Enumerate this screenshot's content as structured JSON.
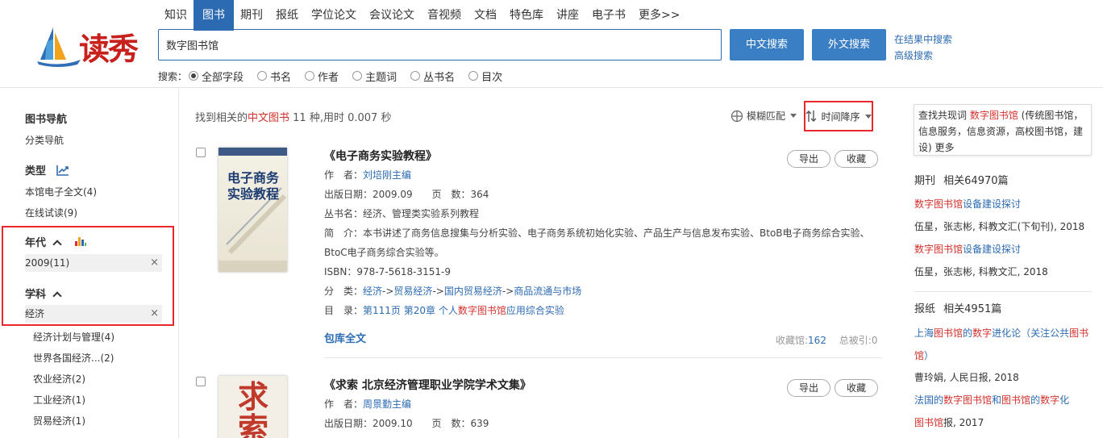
{
  "header": {
    "logo_text": "读秀",
    "nav": [
      "知识",
      "图书",
      "期刊",
      "报纸",
      "学位论文",
      "会议论文",
      "音视频",
      "文档",
      "特色库",
      "讲座",
      "电子书",
      "更多>>"
    ],
    "nav_active": "图书",
    "search_value": "数字图书馆",
    "btn_cn": "中文搜索",
    "btn_en": "外文搜索",
    "link_within": "在结果中搜索",
    "link_advanced": "高级搜索",
    "fields_label": "搜索：",
    "fields": [
      "全部字段",
      "书名",
      "作者",
      "主题词",
      "丛书名",
      "目次"
    ]
  },
  "left": {
    "nav_title": "图书导航",
    "nav_sub": "分类导航",
    "type_title": "类型",
    "type_items": [
      "本馆电子全文(4)",
      "在线试读(9)"
    ],
    "year_title": "年代",
    "year_selected": "2009(11)",
    "subject_title": "学科",
    "subject_selected": "经济",
    "subject_items": [
      "经济计划与管理(4)",
      "世界各国经济...(2)",
      "农业经济(2)",
      "工业经济(1)",
      "贸易经济(1)"
    ],
    "close": "×"
  },
  "main": {
    "summary_prefix": "找到相关的",
    "summary_hl": "中文图书",
    "summary_suffix": " 11 种,用时 0.007 秒",
    "fuzzy": "模糊匹配",
    "sort": "时间降序",
    "books": [
      {
        "title": "《电子商务实验教程》",
        "author_label": "作　者：",
        "author": "刘培刚主编",
        "date_label": "出版日期：",
        "date": "2009.09",
        "pages_label": "页　数：",
        "pages": "364",
        "series_label": "丛书名：",
        "series": "经济、管理类实验系列教程",
        "intro_label": "简　介：",
        "intro_1": "本书讲述了商务信息搜集与分析实验、电子商务系统初始化实验、产品生产与信息发布实验、BtoB电子商务综合实验、",
        "intro_2": "BtoC电子商务综合实验等。",
        "isbn_label": "ISBN：",
        "isbn": "978-7-5618-3151-9",
        "class_label": "分　类：",
        "class": [
          "经济",
          "贸易经济",
          "国内贸易经济",
          "商品流通与市场"
        ],
        "class_sep": "->",
        "toc_label": "目　录：",
        "toc_page": "第111页",
        "toc_chapter": "第20章",
        "toc_a": "个人",
        "toc_hl": "数字图书馆",
        "toc_b": "应用综合实验",
        "export": "导出",
        "collect": "收藏",
        "fulltext": "包库全文",
        "lib_label": "收藏馆:",
        "lib": "162",
        "cite_label": "总被引:",
        "cite": "0",
        "cover_title": "电子商务实验教程"
      },
      {
        "title": "《求索 北京经济管理职业学院学术文集》",
        "author_label": "作　者：",
        "author": "周景勤主编",
        "date_label": "出版日期：",
        "date": "2009.10",
        "pages_label": "页　数：",
        "pages": "639",
        "export": "导出",
        "collect": "收藏",
        "cover_title": "求索"
      }
    ]
  },
  "right": {
    "cooc_prefix": "查找共现词 ",
    "cooc_hl": "数字图书馆",
    "cooc_rest": " (传统图书馆，信息服务，信息资源，高校图书馆，建设)",
    "cooc_more": " 更多",
    "journal_head": "期刊",
    "journal_count": "相关64970篇",
    "journal_items": [
      {
        "title_hl": "数字图书馆",
        "title_rest": "设备建设探讨",
        "meta": "伍星，张志彬, 科教文汇(下旬刊), 2018"
      },
      {
        "title_hl": "数字图书馆",
        "title_rest": "设备建设探讨",
        "meta": "伍星，张志彬, 科教文汇, 2018"
      }
    ],
    "paper_head": "报纸",
    "paper_count": "相关4951篇",
    "paper_items": [
      {
        "t1": "上海",
        "t2": "图书馆",
        "t3": "的",
        "t4": "数字",
        "t5": "进化论（关注公共",
        "t6": "图书馆",
        "t7": "）",
        "meta": "曹玲娟, 人民日报, 2018"
      },
      {
        "t1": "法国的",
        "t2": "数字图书馆",
        "t3": "和",
        "t4": "图书馆",
        "t5": "的",
        "t6": "数字",
        "t7": "化",
        "t8": "图书馆",
        "t9": "报",
        "meta": ", 2017"
      }
    ]
  }
}
